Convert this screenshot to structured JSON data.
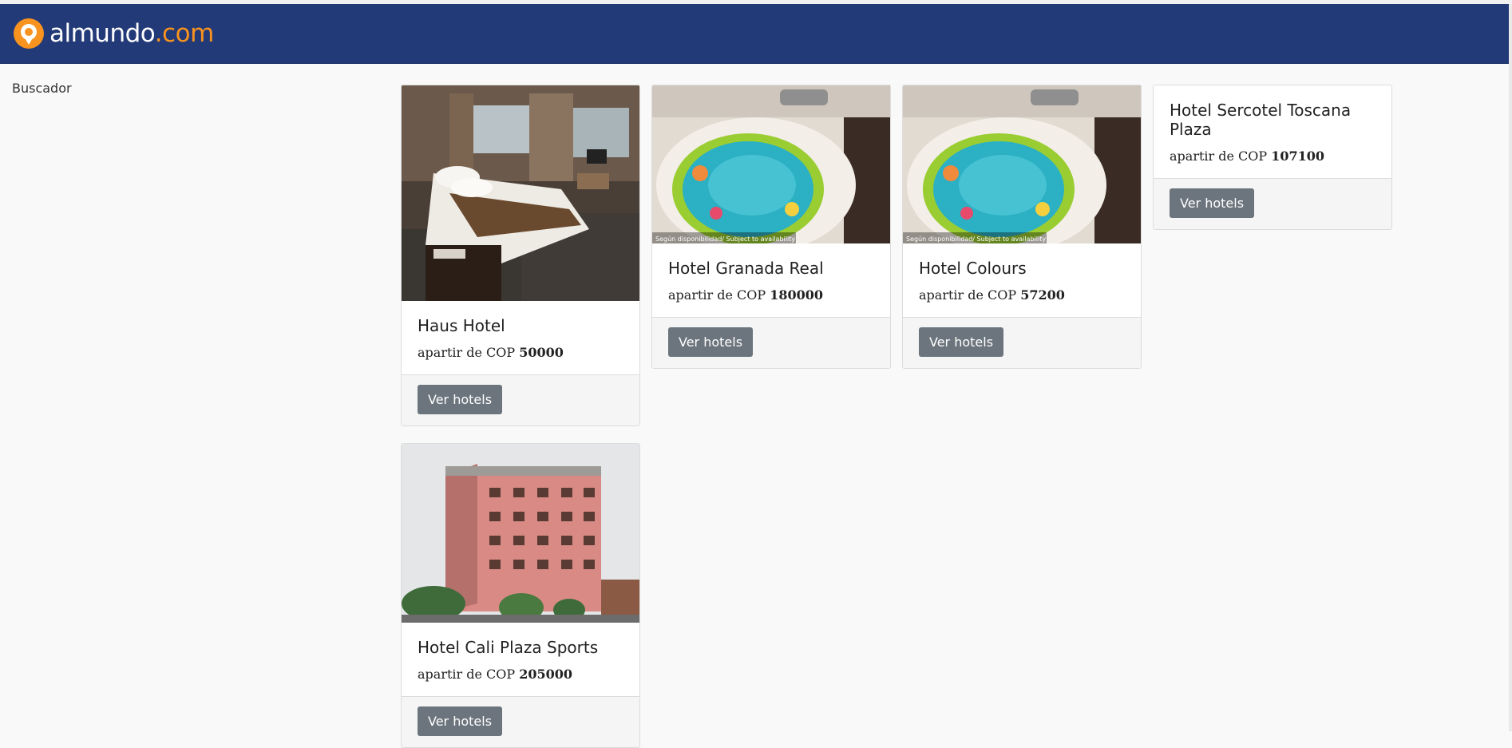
{
  "brand": {
    "logo_name": "almundo",
    "logo_suffix": ".com",
    "accent": "#f7931e",
    "nav_bg": "#233a78"
  },
  "sidebar": {
    "title": "Buscador"
  },
  "hotels": [
    {
      "name": "Haus Hotel",
      "price_prefix": "apartir de COP",
      "price": "50000",
      "button": "Ver hotels",
      "image": "hotel-room-photo"
    },
    {
      "name": "Hotel Granada Real",
      "price_prefix": "apartir de COP",
      "price": "180000",
      "button": "Ver hotels",
      "image": "baby-bathtub-photo",
      "watermark": "Según disponibilidad/ Subject to availability"
    },
    {
      "name": "Hotel Colours",
      "price_prefix": "apartir de COP",
      "price": "57200",
      "button": "Ver hotels",
      "image": "baby-bathtub-photo",
      "watermark": "Según disponibilidad/ Subject to availability"
    },
    {
      "name": "Hotel Sercotel Toscana Plaza",
      "price_prefix": "apartir de COP",
      "price": "107100",
      "button": "Ver hotels",
      "image": "none"
    },
    {
      "name": "Hotel Cali Plaza Sports",
      "price_prefix": "apartir de COP",
      "price": "205000",
      "button": "Ver hotels",
      "image": "hotel-building-photo"
    }
  ]
}
